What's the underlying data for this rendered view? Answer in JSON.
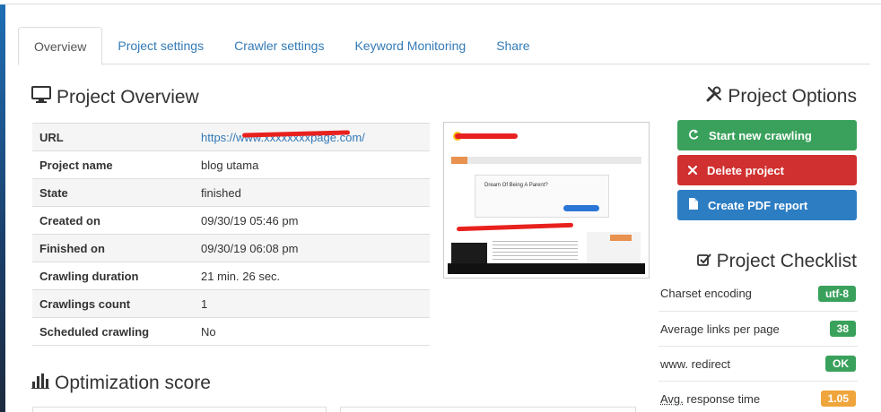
{
  "tabs": [
    {
      "label": "Overview",
      "active": true
    },
    {
      "label": "Project settings",
      "active": false
    },
    {
      "label": "Crawler settings",
      "active": false
    },
    {
      "label": "Keyword Monitoring",
      "active": false
    },
    {
      "label": "Share",
      "active": false
    }
  ],
  "overview": {
    "title": "Project Overview",
    "rows": [
      {
        "key": "URL",
        "value": "https://www.xxxxxxxxpage.com/"
      },
      {
        "key": "Project name",
        "value": "blog utama"
      },
      {
        "key": "State",
        "value": "finished"
      },
      {
        "key": "Created on",
        "value": "09/30/19 05:46 pm"
      },
      {
        "key": "Finished on",
        "value": "09/30/19 06:08 pm"
      },
      {
        "key": "Crawling duration",
        "value": "21 min. 26 sec."
      },
      {
        "key": "Crawlings count",
        "value": "1"
      },
      {
        "key": "Scheduled crawling",
        "value": "No"
      }
    ]
  },
  "thumbnail": {
    "ad_title": "Dream Of Being A Parent?"
  },
  "options": {
    "title": "Project Options",
    "buttons": {
      "start": "Start new crawling",
      "delete": "Delete project",
      "pdf": "Create PDF report"
    }
  },
  "checklist": {
    "title": "Project Checklist",
    "items": [
      {
        "label": "Charset encoding",
        "value": "utf-8",
        "status": "green"
      },
      {
        "label": "Average links per page",
        "value": "38",
        "status": "green"
      },
      {
        "label": "www. redirect",
        "value": "OK",
        "status": "green"
      },
      {
        "label_abbr": "Avg.",
        "label_rest": " response time",
        "value": "1.05",
        "status": "orange"
      }
    ]
  },
  "score": {
    "title": "Optimization score"
  },
  "colors": {
    "green": "#3aa15c",
    "red": "#d0302f",
    "blue": "#2d7dc3",
    "orange": "#efa53b",
    "link": "#337ab7"
  }
}
